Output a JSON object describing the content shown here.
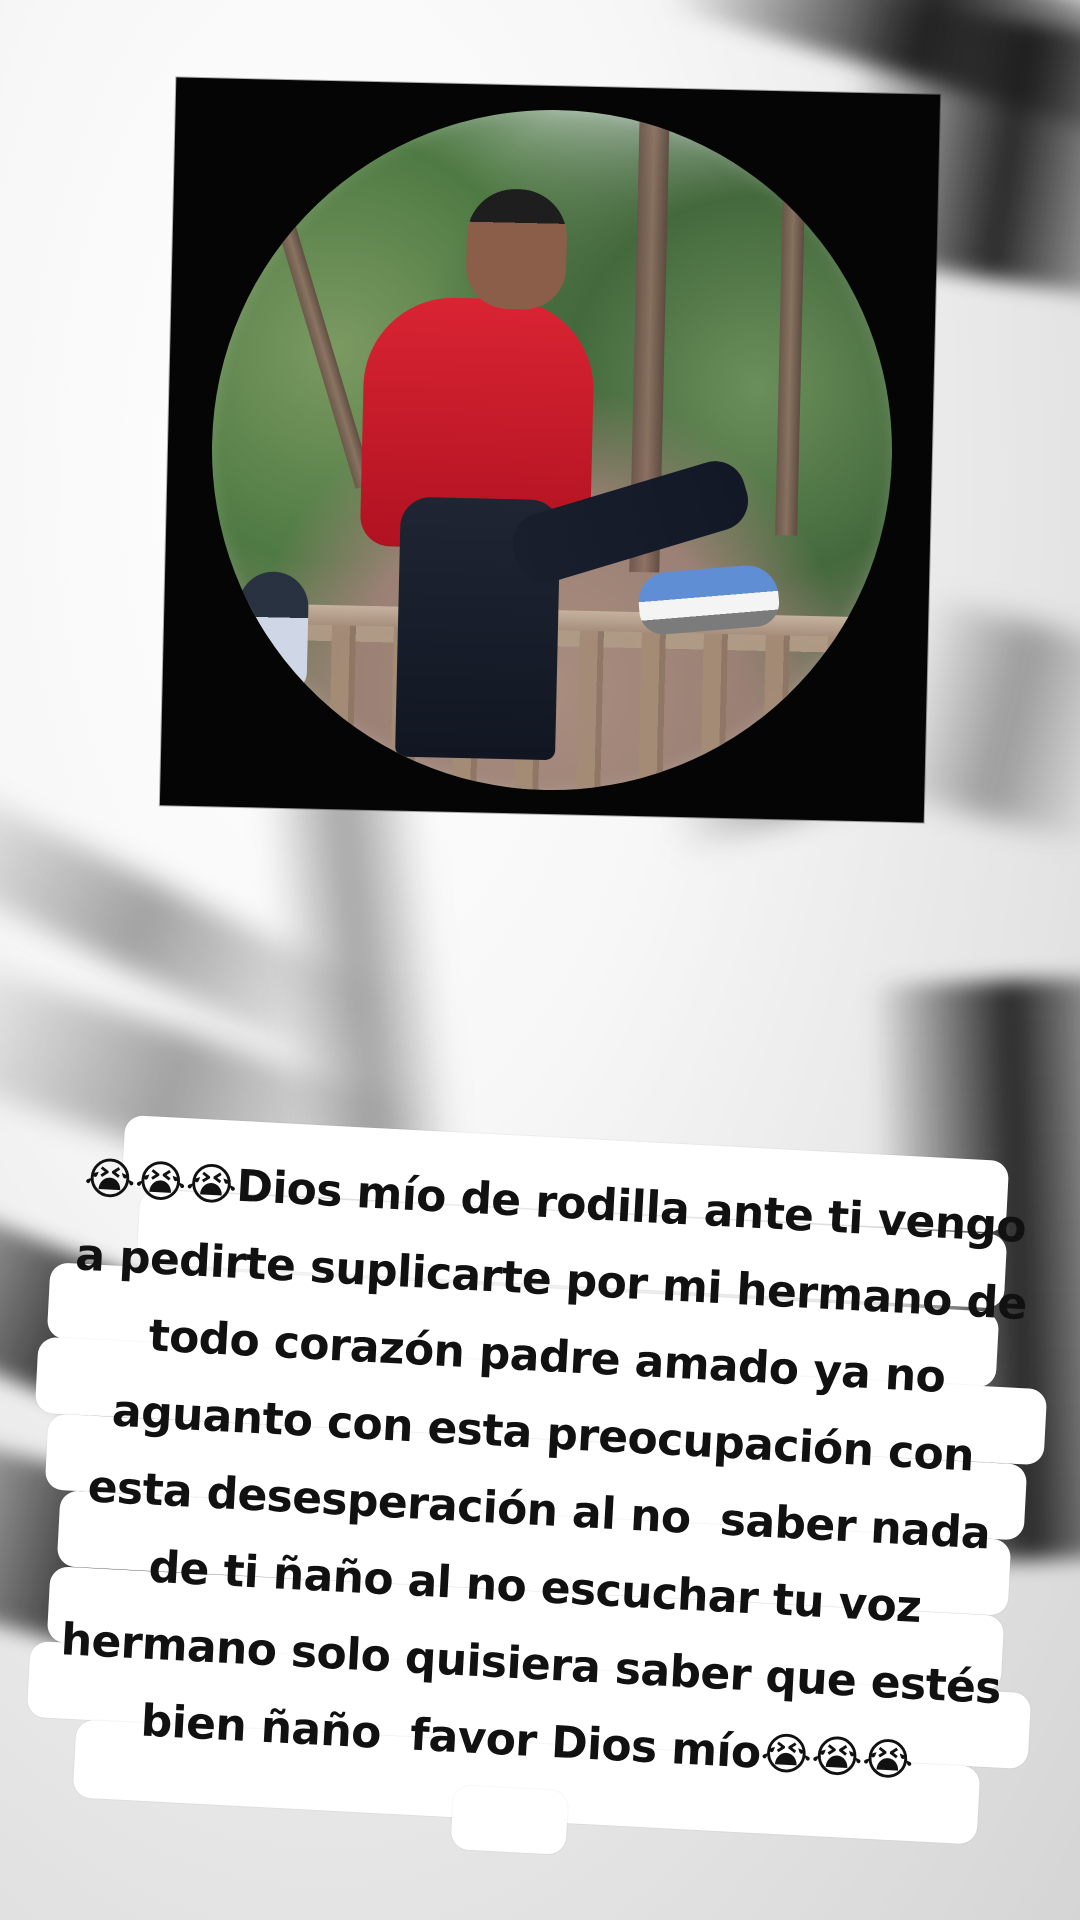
{
  "caption": {
    "text": "😭😭😭Dios mío de rodilla ante ti vengo a pedirte suplicarte por mi hermano de todo corazón padre amado ya no aguanto con esta preocupación con esta desesperación al no  saber nada de ti ñaño al no escuchar tu voz hermano solo quisiera saber que estés bien ñaño  favor Dios mío😭😭😭"
  },
  "colors": {
    "background": "#f4f4f4",
    "frame": "#050505",
    "caption_bg": "#ffffff",
    "caption_text": "#111111"
  }
}
